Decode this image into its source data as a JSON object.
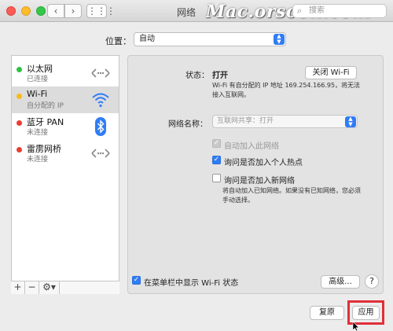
{
  "window": {
    "title": "网络",
    "watermark": "Mac.orsoon.com",
    "search_placeholder": "搜索"
  },
  "location": {
    "label": "位置：",
    "value": "自动"
  },
  "services": [
    {
      "name": "以太网",
      "status": "已连接",
      "state": "green",
      "icon": "ethernet-icon"
    },
    {
      "name": "Wi-Fi",
      "status": "自分配的 IP",
      "state": "yellow",
      "icon": "wifi-icon"
    },
    {
      "name": "蓝牙 PAN",
      "status": "未连接",
      "state": "red",
      "icon": "bluetooth-icon"
    },
    {
      "name": "雷雳网桥",
      "status": "未连接",
      "state": "red",
      "icon": "thunderbolt-bridge-icon"
    }
  ],
  "toolbar": {
    "add": "+",
    "remove": "−",
    "gear": "⚙▾"
  },
  "detail": {
    "status_label": "状态：",
    "status_value": "打开",
    "wifi_off_button": "关闭 Wi-Fi",
    "status_desc": "Wi-Fi 有自分配的 IP 地址 169.254.166.95，将无法接入互联网。",
    "network_label": "网络名称：",
    "network_value": "互联网共享：打开",
    "auto_join": "自动加入此网络",
    "ask_hotspot": "询问是否加入个人热点",
    "ask_new": "询问是否加入新网络",
    "hint": "将自动加入已知网络。如果没有已知网络，您必须手动选择。",
    "show_menubar": "在菜单栏中显示 Wi-Fi 状态",
    "advanced_button": "高级...",
    "help": "?"
  },
  "footer": {
    "revert_button": "复原",
    "apply_button": "应用"
  },
  "colors": {
    "accent": "#2f7cf6",
    "highlight": "#e0303a"
  }
}
